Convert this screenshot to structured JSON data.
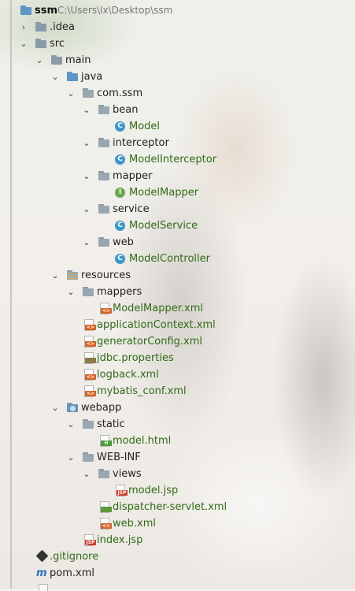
{
  "tree": {
    "root": {
      "label": "ssm",
      "path": "C:\\Users\\lx\\Desktop\\ssm"
    },
    "items": [
      {
        "label": "ssm"
      },
      {
        "label": ".idea"
      },
      {
        "label": "src"
      },
      {
        "label": "main"
      },
      {
        "label": "java"
      },
      {
        "label": "com.ssm"
      },
      {
        "label": "bean"
      },
      {
        "label": "Model"
      },
      {
        "label": "interceptor"
      },
      {
        "label": "ModelInterceptor"
      },
      {
        "label": "mapper"
      },
      {
        "label": "ModelMapper"
      },
      {
        "label": "service"
      },
      {
        "label": "ModelService"
      },
      {
        "label": "web"
      },
      {
        "label": "ModelController"
      },
      {
        "label": "resources"
      },
      {
        "label": "mappers"
      },
      {
        "label": "ModelMapper.xml"
      },
      {
        "label": "applicationContext.xml"
      },
      {
        "label": "generatorConfig.xml"
      },
      {
        "label": "jdbc.properties"
      },
      {
        "label": "logback.xml"
      },
      {
        "label": "mybatis_conf.xml"
      },
      {
        "label": "webapp"
      },
      {
        "label": "static"
      },
      {
        "label": "model.html"
      },
      {
        "label": "WEB-INF"
      },
      {
        "label": "views"
      },
      {
        "label": "model.jsp"
      },
      {
        "label": "dispatcher-servlet.xml"
      },
      {
        "label": "web.xml"
      },
      {
        "label": "index.jsp"
      },
      {
        "label": ".gitignore"
      },
      {
        "label": "pom.xml"
      }
    ]
  },
  "icons": {
    "class": "C",
    "interface": "I",
    "xml_badge": "<>",
    "jsp_badge": "JSP",
    "html_badge": "H",
    "maven": "m",
    "expanded": "⌄",
    "collapsed": "›"
  }
}
